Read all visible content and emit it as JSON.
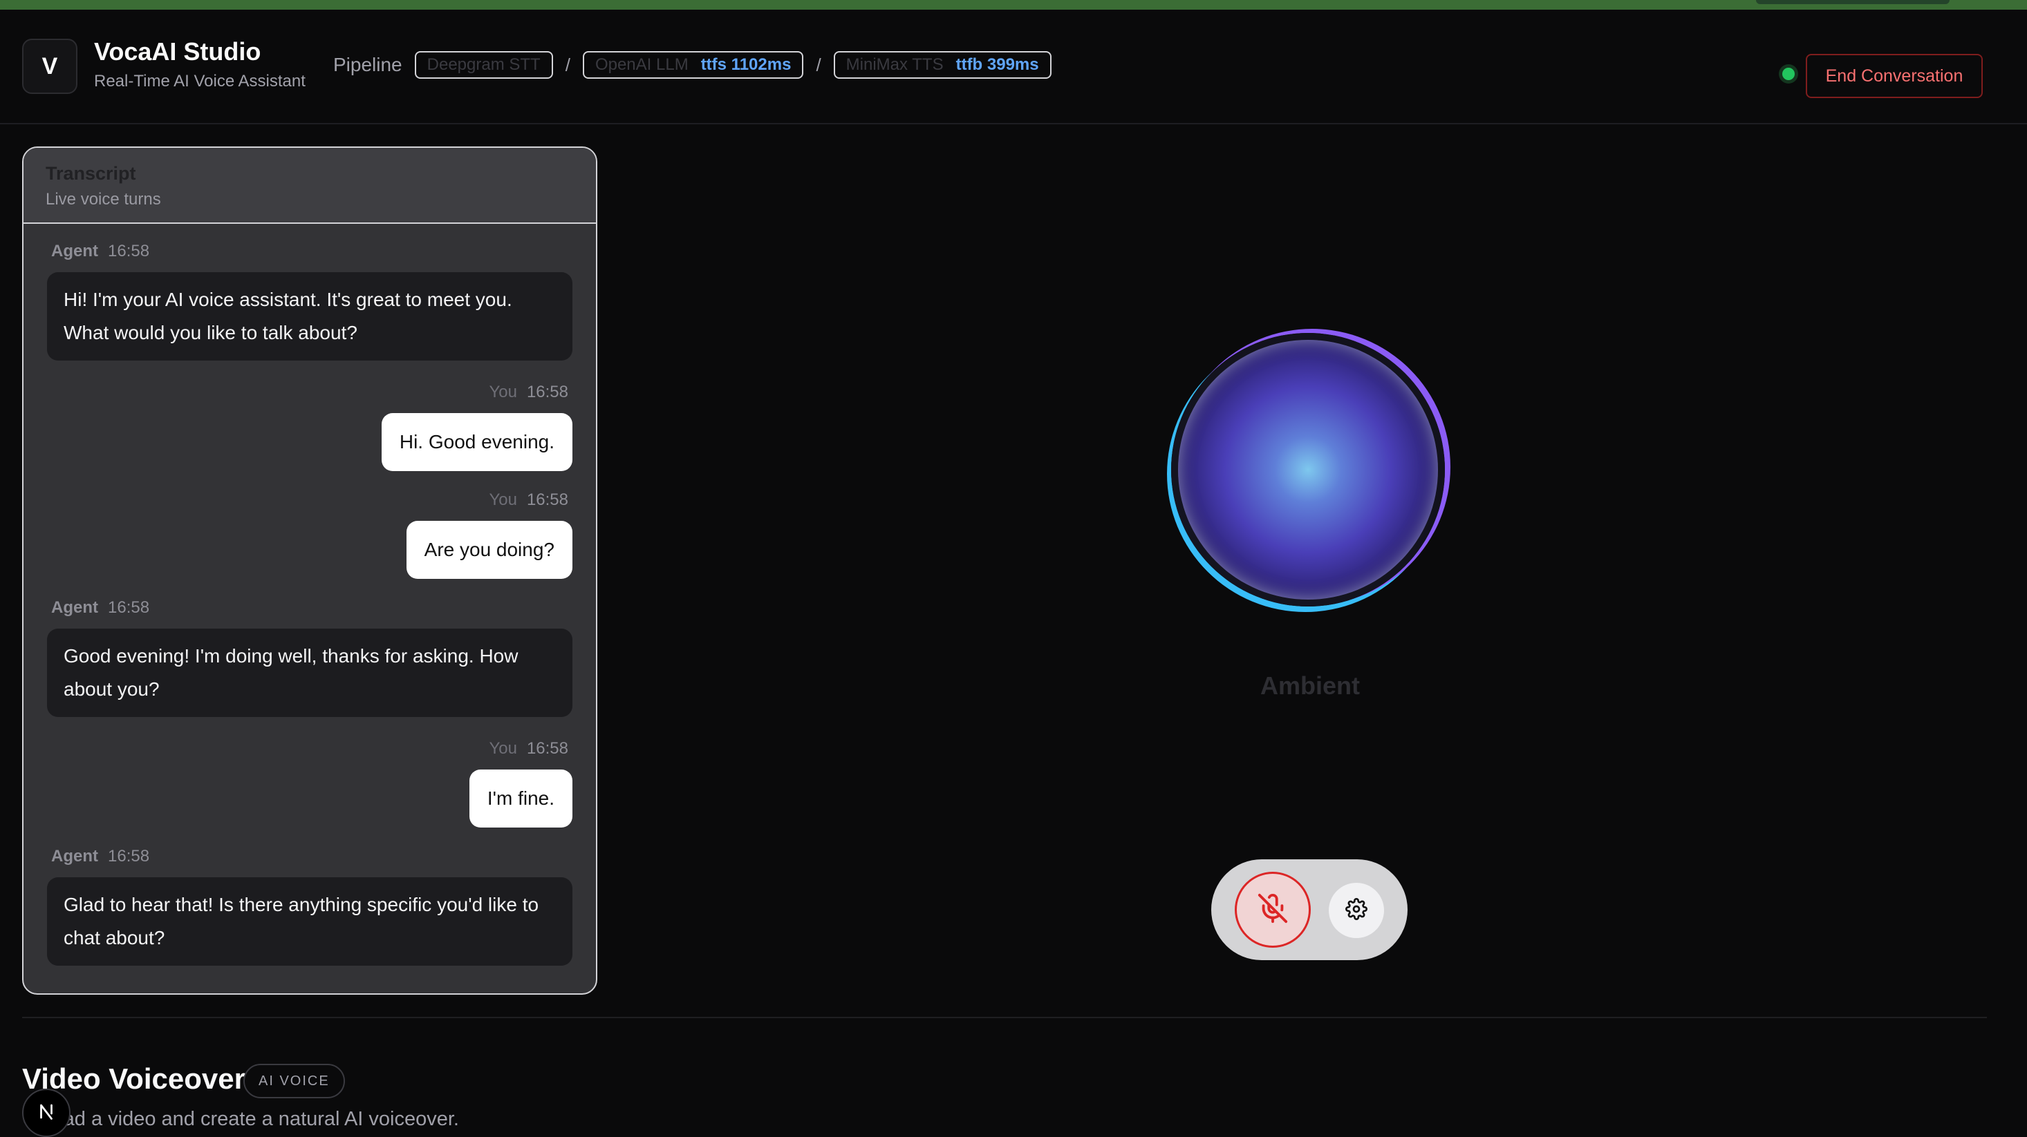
{
  "header": {
    "logo_letter": "V",
    "title": "VocaAI Studio",
    "subtitle": "Real-Time AI Voice Assistant",
    "pipeline_label": "Pipeline",
    "pipeline": [
      {
        "name": "Deepgram STT",
        "metric": ""
      },
      {
        "name": "OpenAI LLM",
        "metric": "ttfs 1102ms"
      },
      {
        "name": "MiniMax TTS",
        "metric": "ttfb 399ms"
      }
    ],
    "separator": "/",
    "status_color": "#22c55e",
    "end_button": "End Conversation"
  },
  "transcript": {
    "title": "Transcript",
    "subtitle": "Live voice turns",
    "messages": [
      {
        "role": "Agent",
        "time": "16:58",
        "text": "Hi! I'm your AI voice assistant. It's great to meet you. What would you like to talk about?"
      },
      {
        "role": "You",
        "time": "16:58",
        "text": "Hi. Good evening."
      },
      {
        "role": "You",
        "time": "16:58",
        "text": "Are you doing?"
      },
      {
        "role": "Agent",
        "time": "16:58",
        "text": "Good evening! I'm doing well, thanks for asking. How about you?"
      },
      {
        "role": "You",
        "time": "16:58",
        "text": "I'm fine."
      },
      {
        "role": "Agent",
        "time": "16:58",
        "text": "Glad to hear that! Is there anything specific you'd like to chat about?"
      }
    ]
  },
  "visualizer": {
    "state_label": "Ambient"
  },
  "controls": {
    "mic_icon": "mic-off-icon",
    "settings_icon": "gear-icon",
    "mic_color": "#dc2626"
  },
  "voiceover": {
    "title": "Video Voiceover",
    "badge": "AI VOICE",
    "description": "Upload a video and create a natural AI voiceover.",
    "avatar_letter": "N"
  }
}
